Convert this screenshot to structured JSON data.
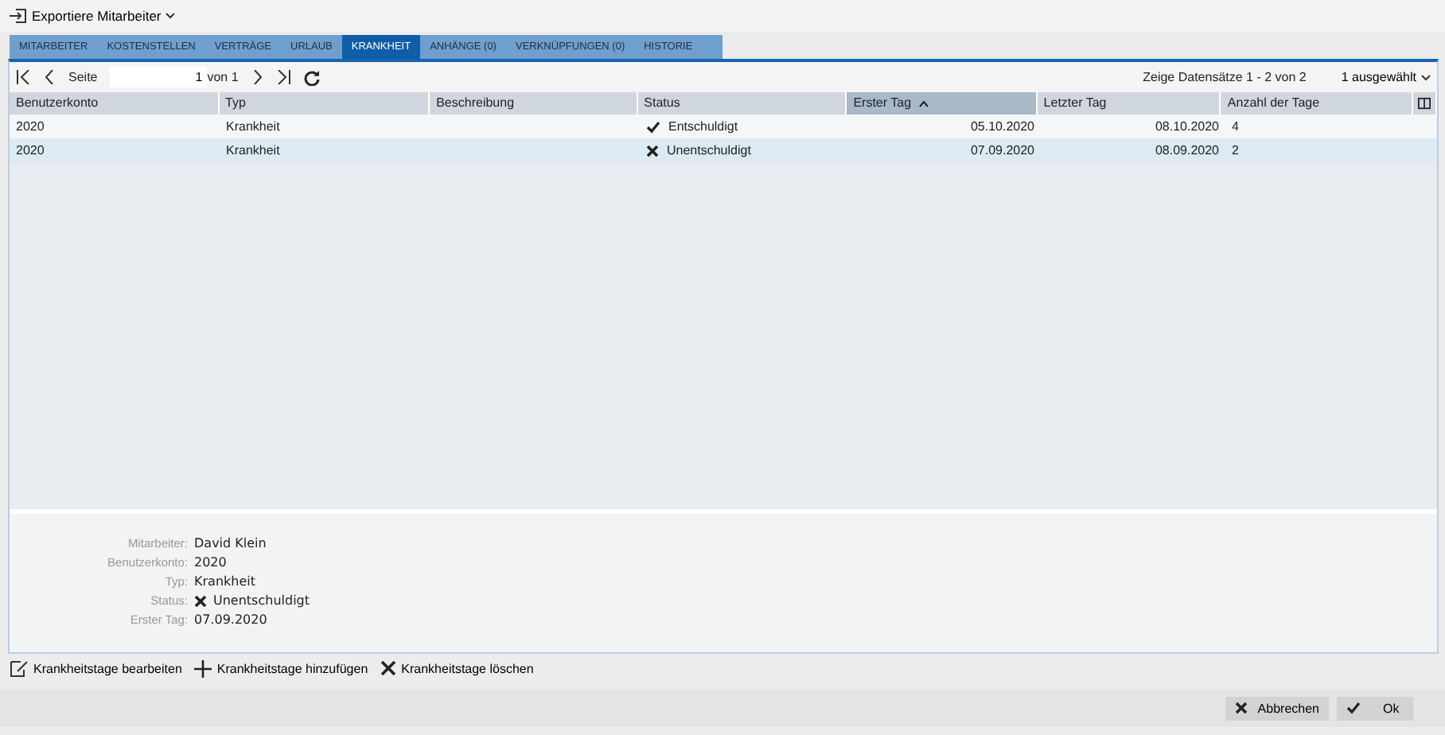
{
  "menu": {
    "label": "Exportiere Mitarbeiter"
  },
  "tabs": [
    {
      "label": "MITARBEITER",
      "selected": false
    },
    {
      "label": "KOSTENSTELLEN",
      "selected": false
    },
    {
      "label": "VERTRÄGE",
      "selected": false
    },
    {
      "label": "URLAUB",
      "selected": false
    },
    {
      "label": "KRANKHEIT",
      "selected": true
    },
    {
      "label": "ANHÄNGE (0)",
      "selected": false
    },
    {
      "label": "VERKNÜPFUNGEN (0)",
      "selected": false
    },
    {
      "label": "HISTORIE",
      "selected": false
    }
  ],
  "pager": {
    "page_label": "Seite",
    "page": "1",
    "of": "von 1",
    "records": "Zeige Datensätze 1 - 2 von 2",
    "selection": "1 ausgewählt"
  },
  "table": {
    "columns": [
      {
        "label": "Benutzerkonto",
        "sorted": false,
        "kind": "text"
      },
      {
        "label": "Typ",
        "sorted": false,
        "kind": "text"
      },
      {
        "label": "Beschreibung",
        "sorted": false,
        "kind": "text"
      },
      {
        "label": "Status",
        "sorted": false,
        "kind": "text"
      },
      {
        "label": "Erster Tag",
        "sorted": true,
        "kind": "date"
      },
      {
        "label": "Letzter Tag",
        "sorted": false,
        "kind": "date"
      },
      {
        "label": "Anzahl der Tage",
        "sorted": false,
        "kind": "text"
      }
    ],
    "rows": [
      {
        "selected": false,
        "kind": "excused",
        "cells": [
          "2020",
          "Krankheit",
          "",
          "Entschuldigt",
          "05.10.2020",
          "08.10.2020",
          "4"
        ]
      },
      {
        "selected": true,
        "kind": "unexcused",
        "cells": [
          "2020",
          "Krankheit",
          "",
          "Unentschuldigt",
          "07.09.2020",
          "08.09.2020",
          "2"
        ]
      }
    ]
  },
  "details": [
    {
      "label": "Mitarbeiter:",
      "value": "David Klein",
      "kind": "text"
    },
    {
      "label": "Benutzerkonto:",
      "value": "2020",
      "kind": "text"
    },
    {
      "label": "Typ:",
      "value": "Krankheit",
      "kind": "text"
    },
    {
      "label": "Status:",
      "value": "Unentschuldigt",
      "kind": "unexcused"
    },
    {
      "label": "Erster Tag:",
      "value": "07.09.2020",
      "kind": "text"
    }
  ],
  "actions": [
    {
      "label": "Krankheitstage bearbeiten",
      "kind": "edit"
    },
    {
      "label": "Krankheitstage hinzufügen",
      "kind": "add"
    },
    {
      "label": "Krankheitstage löschen",
      "kind": "delete"
    }
  ],
  "buttons": [
    {
      "label": "Abbrechen",
      "kind": "cancel"
    },
    {
      "label": "Ok",
      "kind": "ok"
    }
  ]
}
